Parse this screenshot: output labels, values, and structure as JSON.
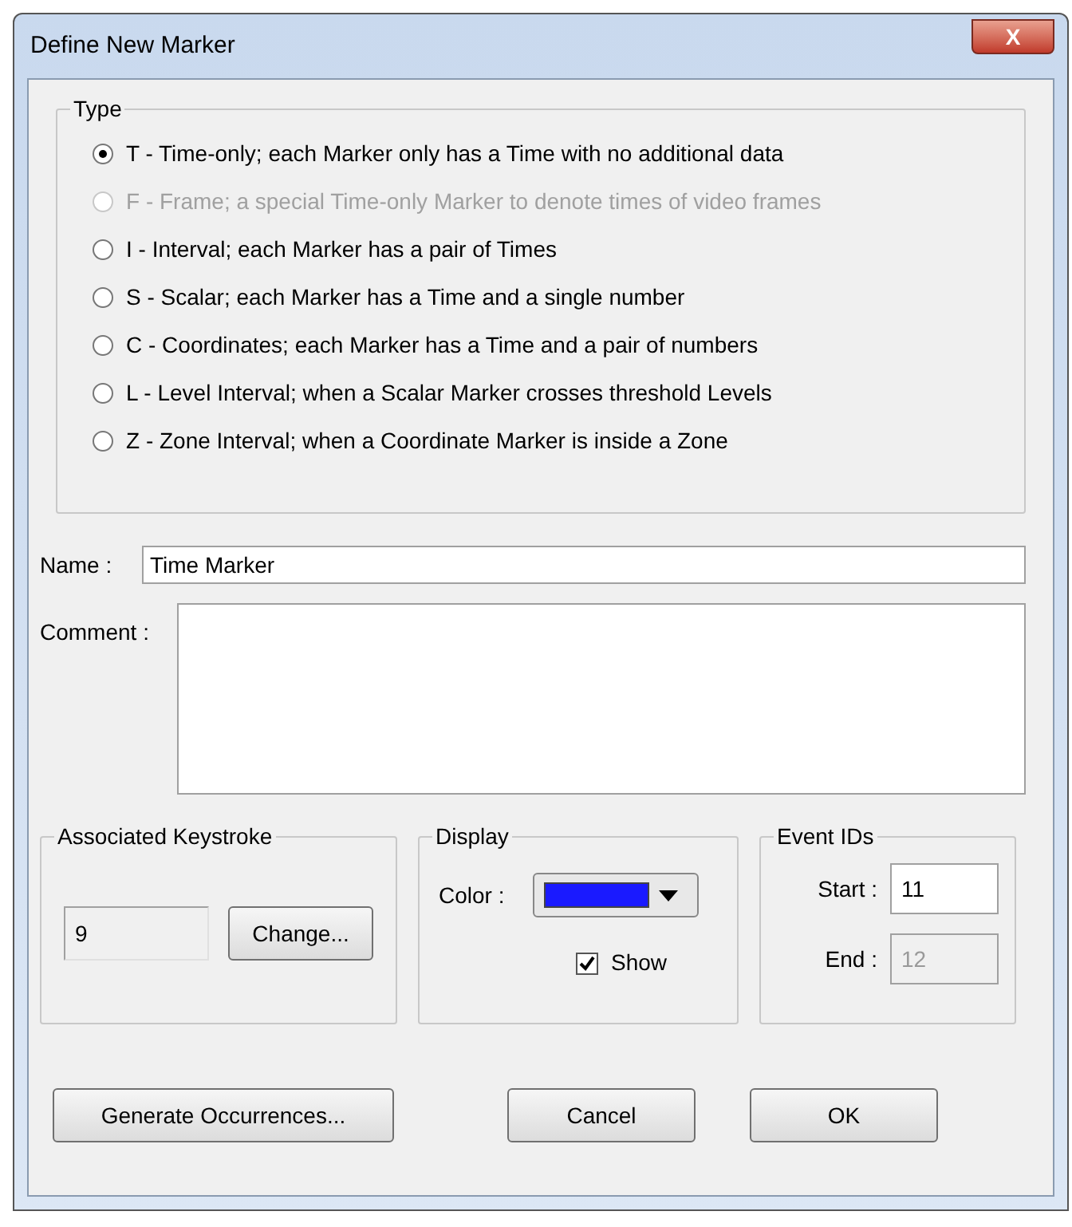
{
  "window": {
    "title": "Define New Marker",
    "close": "X"
  },
  "type_group": {
    "title": "Type",
    "options": [
      {
        "label": "T - Time-only; each Marker only has a Time with no additional data",
        "selected": true,
        "disabled": false
      },
      {
        "label": "F - Frame; a special Time-only Marker to denote times of video frames",
        "selected": false,
        "disabled": true
      },
      {
        "label": "I - Interval; each Marker has a pair of Times",
        "selected": false,
        "disabled": false
      },
      {
        "label": "S - Scalar; each Marker has a Time and a single number",
        "selected": false,
        "disabled": false
      },
      {
        "label": "C - Coordinates; each Marker has a Time and a pair of numbers",
        "selected": false,
        "disabled": false
      },
      {
        "label": "L - Level Interval; when a Scalar Marker crosses threshold Levels",
        "selected": false,
        "disabled": false
      },
      {
        "label": "Z - Zone Interval; when a Coordinate Marker is inside a Zone",
        "selected": false,
        "disabled": false
      }
    ]
  },
  "name": {
    "label": "Name :",
    "value": "Time Marker"
  },
  "comment": {
    "label": "Comment :"
  },
  "keystroke": {
    "title": "Associated Keystroke",
    "value": "9",
    "button": "Change..."
  },
  "display": {
    "title": "Display",
    "color_label": "Color :",
    "color": "#1a1aff",
    "show": {
      "label": "Show",
      "checked": true
    }
  },
  "event_ids": {
    "title": "Event IDs",
    "start_label": "Start :",
    "start": "11",
    "end_label": "End :",
    "end": "12"
  },
  "buttons": [
    "Generate Occurrences...",
    "Cancel",
    "OK"
  ]
}
